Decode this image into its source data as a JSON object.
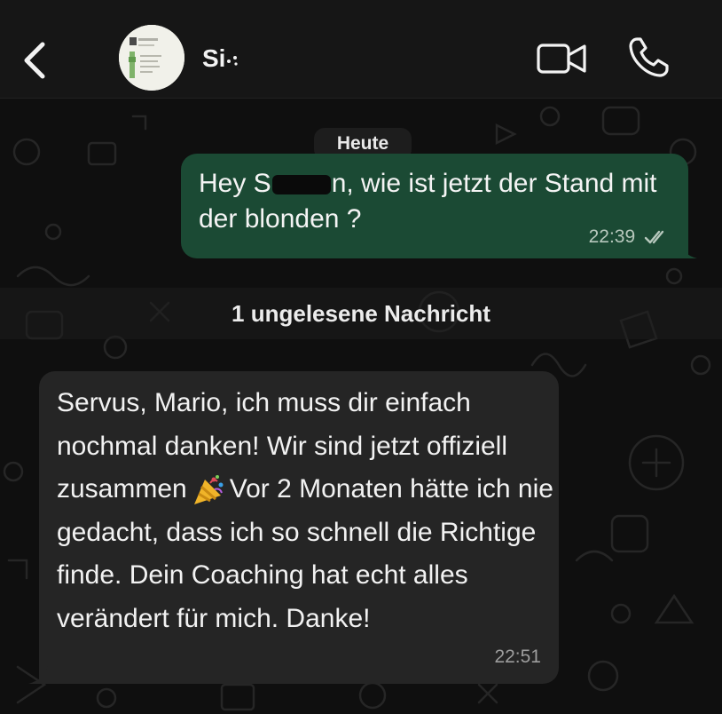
{
  "header": {
    "contact_name": "Si",
    "icons": {
      "back": "chevron-left-icon",
      "video": "video-camera-icon",
      "call": "phone-icon"
    }
  },
  "chat": {
    "date_label": "Heute",
    "outgoing": {
      "text_before": "Hey S",
      "text_after": "n, wie ist jetzt der Stand mit der blonden ?",
      "time": "22:39",
      "status_icon": "double-check-read-icon"
    },
    "unread_label": "1 ungelesene Nachricht",
    "incoming": {
      "text_before": "Servus, Mario, ich muss dir einfach nochmal danken! Wir sind jetzt offiziell zusammen",
      "emoji": "party-popper-icon",
      "text_after": "Vor 2 Monaten hätte ich nie gedacht, dass ich so schnell die Richtige finde. Dein Coaching hat echt alles verändert für mich. Danke!",
      "time": "22:51"
    }
  },
  "colors": {
    "background": "#0b0b0b",
    "header": "#161616",
    "outgoing_bubble": "#1b4a34",
    "incoming_bubble": "#252525",
    "text": "#f2f2f2"
  }
}
